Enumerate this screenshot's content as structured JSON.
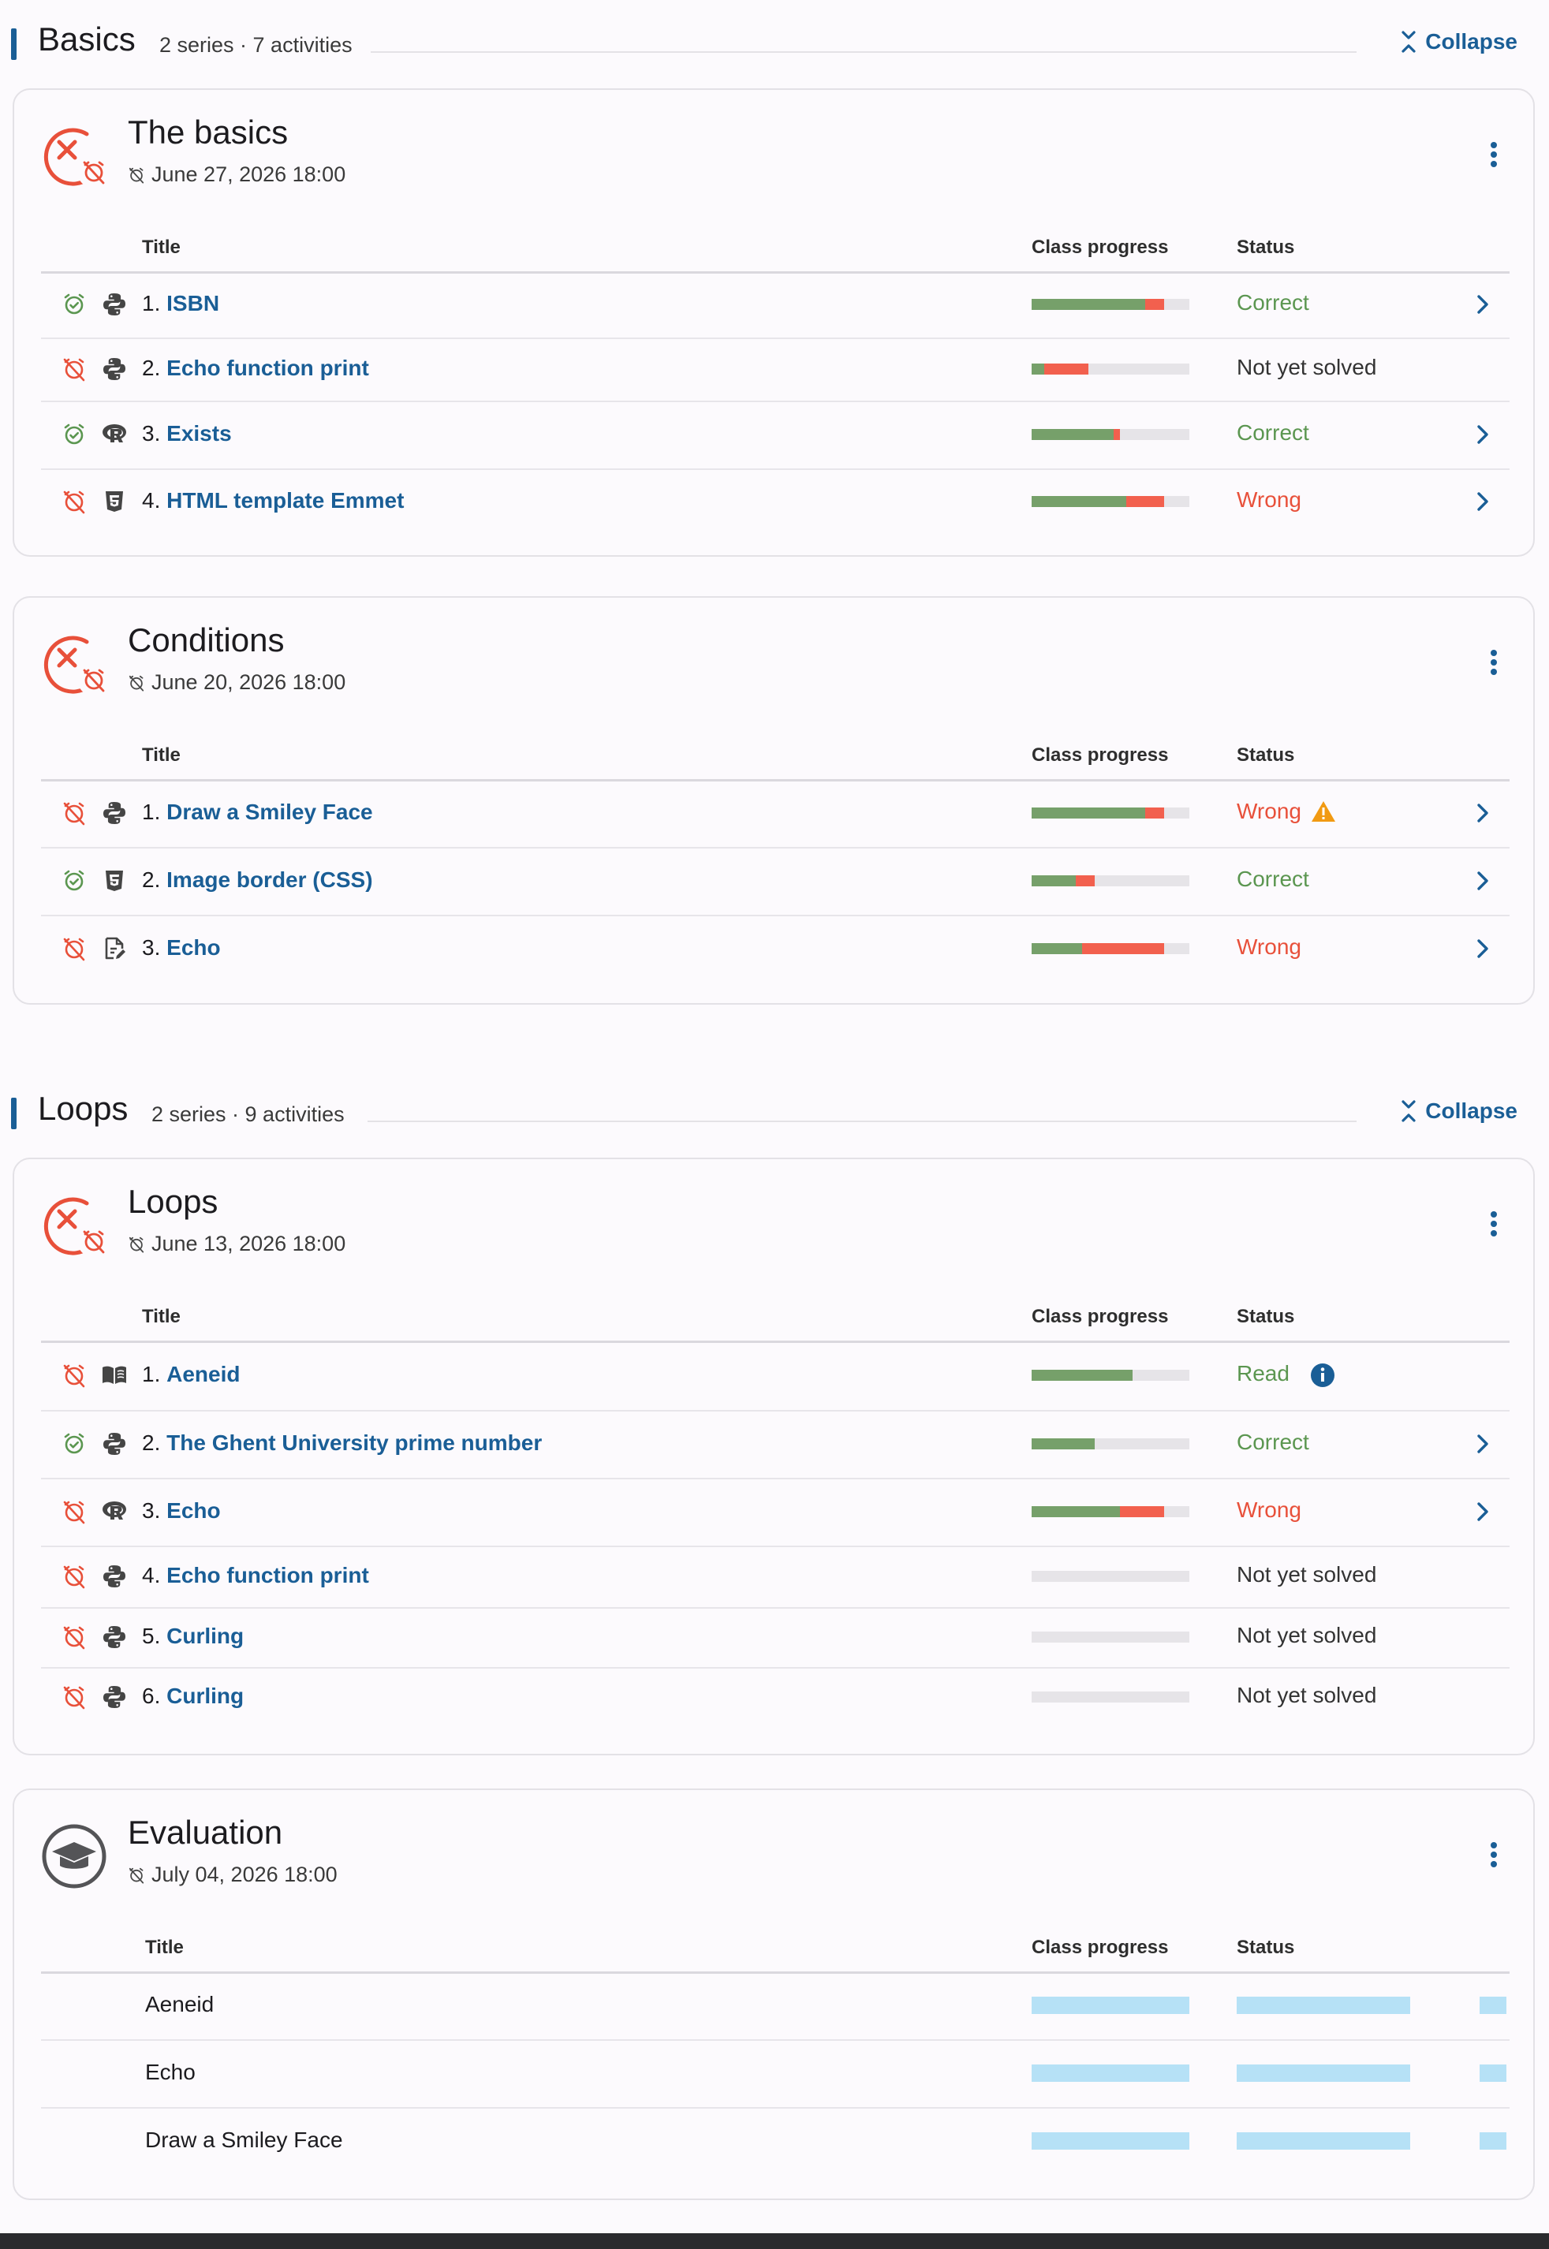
{
  "colors": {
    "link": "#1a5e96",
    "correct": "#5b9650",
    "wrong": "#e8503a",
    "progress_green": "#76a06a",
    "progress_red": "#f2604e",
    "warning": "#f19a12",
    "skeleton": "#b6e1f6"
  },
  "table_headers": {
    "title": "Title",
    "progress": "Class progress",
    "status": "Status"
  },
  "sections": [
    {
      "title": "Basics",
      "meta": "2 series · 7 activities",
      "collapse_label": "Collapse",
      "cards": [
        {
          "title": "The basics",
          "deadline": "June 27, 2026 18:00",
          "icon": "missed-deadline-icon",
          "rows": [
            {
              "num": "1.",
              "name": "ISBN",
              "type_icon": "python-icon",
              "deadline_met": true,
              "progress": {
                "correct": 0.72,
                "wrong": 0.12
              },
              "status": "Correct",
              "status_kind": "correct",
              "chevron": true
            },
            {
              "num": "2.",
              "name": "Echo function print",
              "type_icon": "python-icon",
              "deadline_met": false,
              "progress": {
                "correct": 0.08,
                "wrong": 0.28
              },
              "status": "Not yet solved",
              "status_kind": "none",
              "chevron": false
            },
            {
              "num": "3.",
              "name": "Exists",
              "type_icon": "r-language-icon",
              "deadline_met": true,
              "progress": {
                "correct": 0.52,
                "wrong": 0.04
              },
              "status": "Correct",
              "status_kind": "correct",
              "chevron": true
            },
            {
              "num": "4.",
              "name": "HTML template Emmet",
              "type_icon": "html5-icon",
              "deadline_met": false,
              "progress": {
                "correct": 0.6,
                "wrong": 0.24
              },
              "status": "Wrong",
              "status_kind": "wrong",
              "chevron": true
            }
          ]
        },
        {
          "title": "Conditions",
          "deadline": "June 20, 2026 18:00",
          "icon": "missed-deadline-icon",
          "rows": [
            {
              "num": "1.",
              "name": "Draw a Smiley Face",
              "type_icon": "python-icon",
              "deadline_met": false,
              "progress": {
                "correct": 0.72,
                "wrong": 0.12
              },
              "status": "Wrong",
              "status_kind": "wrong",
              "warning": true,
              "chevron": true
            },
            {
              "num": "2.",
              "name": "Image border (CSS)",
              "type_icon": "html5-icon",
              "deadline_met": true,
              "progress": {
                "correct": 0.28,
                "wrong": 0.12
              },
              "status": "Correct",
              "status_kind": "correct",
              "chevron": true
            },
            {
              "num": "3.",
              "name": "Echo",
              "type_icon": "file-edit-icon",
              "deadline_met": false,
              "progress": {
                "correct": 0.32,
                "wrong": 0.52
              },
              "status": "Wrong",
              "status_kind": "wrong",
              "chevron": true
            }
          ]
        }
      ]
    },
    {
      "title": "Loops",
      "meta": "2 series · 9 activities",
      "collapse_label": "Collapse",
      "cards": [
        {
          "title": "Loops",
          "deadline": "June 13, 2026 18:00",
          "icon": "missed-deadline-icon",
          "rows": [
            {
              "num": "1.",
              "name": "Aeneid",
              "type_icon": "book-icon",
              "deadline_met": false,
              "progress": {
                "correct": 0.64,
                "wrong": 0
              },
              "status": "Read",
              "status_kind": "read",
              "info": true,
              "chevron": false
            },
            {
              "num": "2.",
              "name": "The Ghent University prime number",
              "type_icon": "python-icon",
              "deadline_met": true,
              "progress": {
                "correct": 0.4,
                "wrong": 0
              },
              "status": "Correct",
              "status_kind": "correct",
              "chevron": true
            },
            {
              "num": "3.",
              "name": "Echo",
              "type_icon": "r-language-icon",
              "deadline_met": false,
              "progress": {
                "correct": 0.56,
                "wrong": 0.28
              },
              "status": "Wrong",
              "status_kind": "wrong",
              "chevron": true
            },
            {
              "num": "4.",
              "name": "Echo function print",
              "type_icon": "python-icon",
              "deadline_met": false,
              "progress": {
                "correct": 0,
                "wrong": 0
              },
              "status": "Not yet solved",
              "status_kind": "none",
              "chevron": false
            },
            {
              "num": "5.",
              "name": "Curling",
              "type_icon": "python-icon",
              "deadline_met": false,
              "progress": {
                "correct": 0,
                "wrong": 0
              },
              "status": "Not yet solved",
              "status_kind": "none",
              "chevron": false
            },
            {
              "num": "6.",
              "name": "Curling",
              "type_icon": "python-icon",
              "deadline_met": false,
              "progress": {
                "correct": 0,
                "wrong": 0
              },
              "status": "Not yet solved",
              "status_kind": "none",
              "chevron": false
            }
          ]
        },
        {
          "title": "Evaluation",
          "deadline": "July 04, 2026 18:00",
          "icon": "graduation-cap-icon",
          "rows": [
            {
              "name": "Aeneid",
              "loading": true
            },
            {
              "name": "Echo",
              "loading": true
            },
            {
              "name": "Draw a Smiley Face",
              "loading": true
            }
          ]
        }
      ]
    }
  ]
}
